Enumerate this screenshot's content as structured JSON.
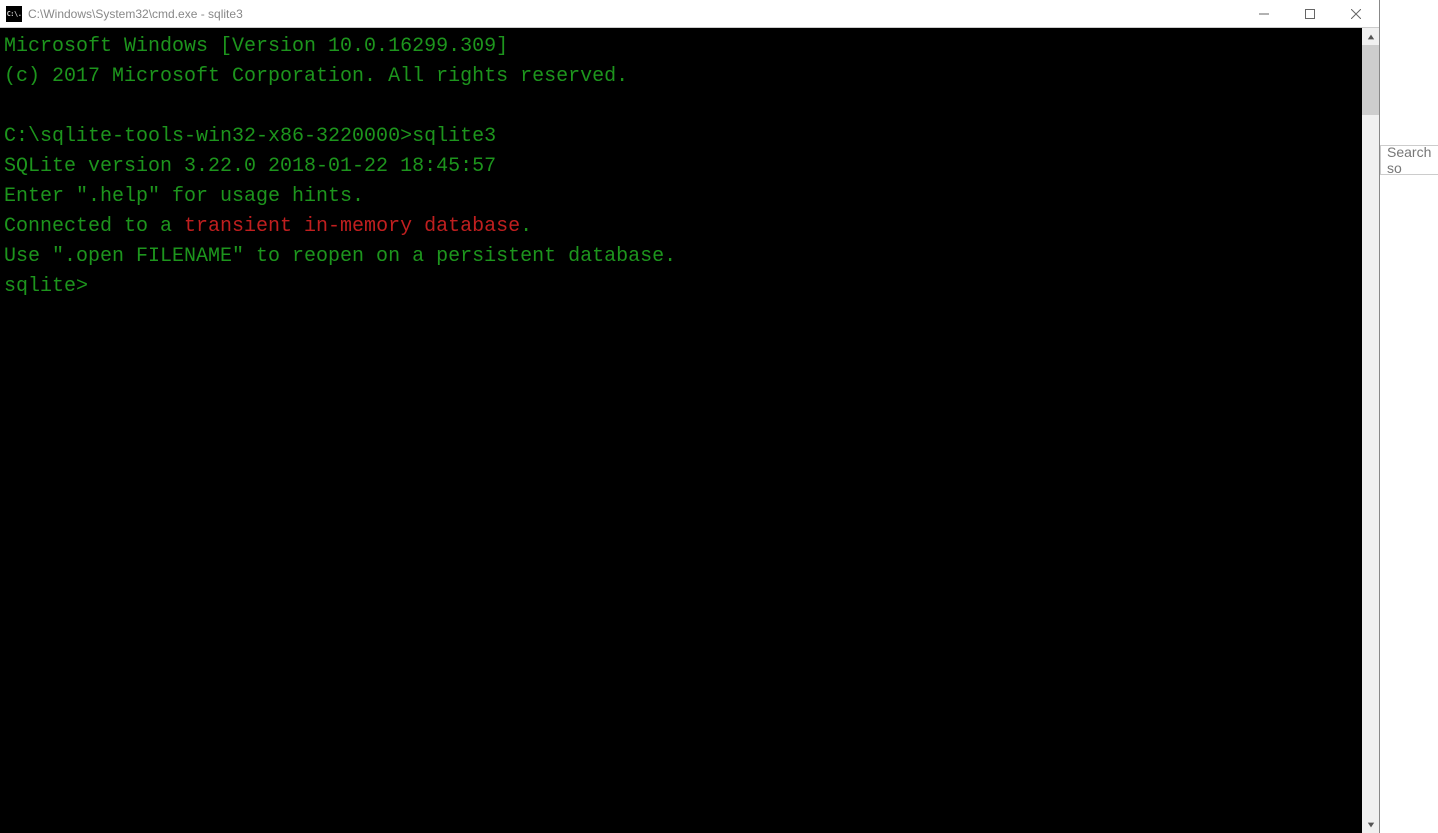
{
  "window": {
    "title": "C:\\Windows\\System32\\cmd.exe - sqlite3",
    "icon_label": "C:\\."
  },
  "terminal": {
    "line1": "Microsoft Windows [Version 10.0.16299.309]",
    "line2": "(c) 2017 Microsoft Corporation. All rights reserved.",
    "blank1": "",
    "line3": "C:\\sqlite-tools-win32-x86-3220000>sqlite3",
    "line4": "SQLite version 3.22.0 2018-01-22 18:45:57",
    "line5": "Enter \".help\" for usage hints.",
    "line6a": "Connected to a ",
    "line6b": "transient in-memory database",
    "line6c": ".",
    "line7": "Use \".open FILENAME\" to reopen on a persistent database.",
    "prompt": "sqlite> "
  },
  "background": {
    "search_placeholder": "Search so"
  }
}
